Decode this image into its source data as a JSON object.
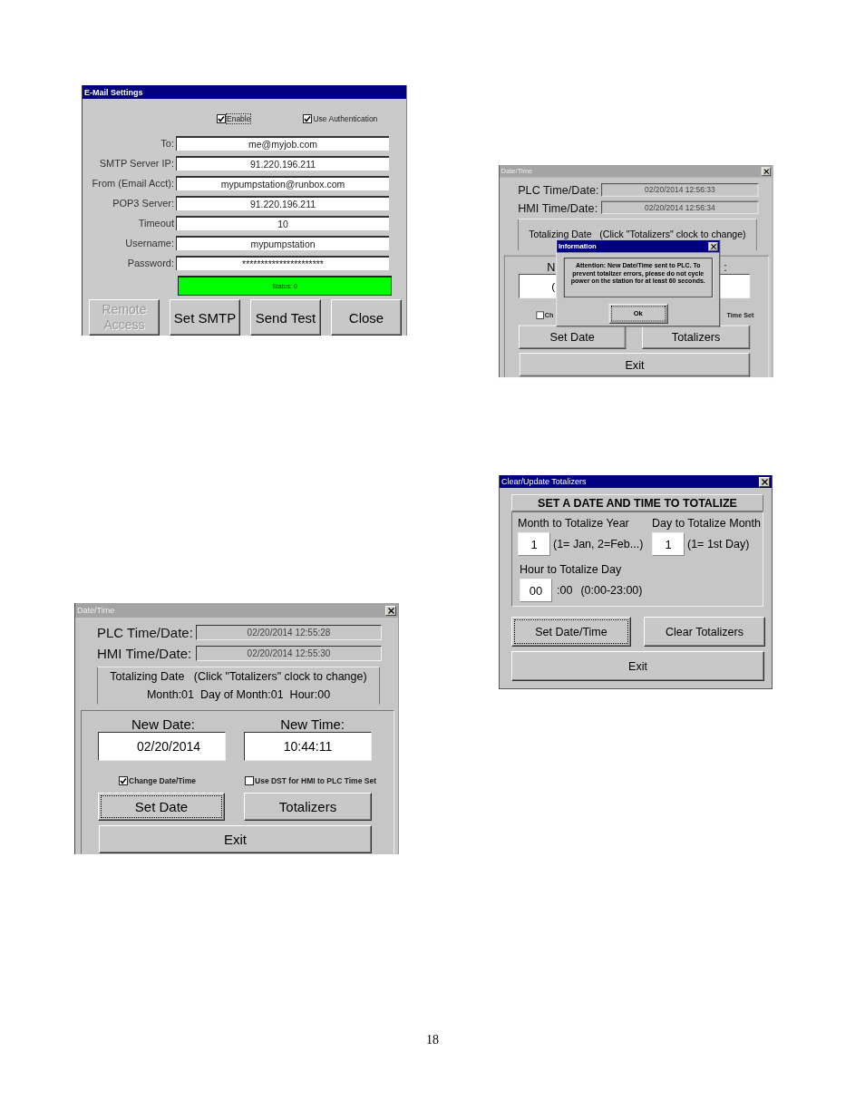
{
  "email_settings": {
    "title": "E-Mail Settings",
    "active": true,
    "checkboxes": [
      {
        "label": "Enable",
        "checked": true,
        "focused": true
      },
      {
        "label": "Use Authentication",
        "checked": true,
        "focused": false
      }
    ],
    "fields": [
      {
        "label": "To:",
        "value": "me@myjob.com"
      },
      {
        "label": "SMTP Server IP:",
        "value": "91.220.196.211"
      },
      {
        "label": "From (Email Acct):",
        "value": "mypumpstation@runbox.com"
      },
      {
        "label": "POP3 Server:",
        "value": "91.220.196.211"
      },
      {
        "label": "Timeout",
        "value": "10"
      },
      {
        "label": "Username:",
        "value": "mypumpstation"
      },
      {
        "label": "Password:",
        "value": "**********************"
      }
    ],
    "status": "Status: 0",
    "buttons": [
      {
        "label": "Remote Access",
        "disabled": true
      },
      {
        "label": "Set SMTP",
        "disabled": false
      },
      {
        "label": "Send Test",
        "disabled": false
      },
      {
        "label": "Close",
        "disabled": false
      }
    ]
  },
  "date_time_with_message": {
    "title": "Date/Time",
    "active": false,
    "close_button": true,
    "plc": {
      "label": "PLC Time/Date:",
      "value": "02/20/2014 12:56:33"
    },
    "hmi": {
      "label": "HMI Time/Date:",
      "value": "02/20/2014 12:56:34"
    },
    "totalizing": [
      "Totalizing Date   (Click \"Totalizers\" clock to change)"
    ],
    "new_date": {
      "label": "N",
      "value": "("
    },
    "new_time": {
      "label": ":"
    },
    "checkboxes": [
      {
        "label": "Ch",
        "checked": false
      },
      {
        "label": "Time Set"
      }
    ],
    "buttons": [
      {
        "label": "Set Date",
        "focused": false
      },
      {
        "label": "Totalizers",
        "focused": false
      }
    ],
    "exit": "Exit",
    "message": {
      "title": "Information",
      "active": true,
      "close_button": true,
      "text": "Attention: New Date/Time sent to PLC. To prevent totalizer errors, please do not cycle power on the station for at least 60 seconds.",
      "button": "Ok",
      "button_focused": true
    }
  },
  "clear_totalizers": {
    "title": "Clear/Update Totalizers",
    "active": true,
    "close_button": true,
    "heading": "SET A DATE AND TIME TO TOTALIZE",
    "inputs": [
      {
        "label": "Month to Totalize Year",
        "value": "1",
        "hint": "(1= Jan, 2=Feb...)"
      },
      {
        "label": "Day to Totalize Month",
        "value": "1",
        "hint": "(1= 1st Day)"
      },
      {
        "label": "Hour to Totalize Day",
        "value": "00",
        "suffix": ":00",
        "hint": "(0:00-23:00)"
      }
    ],
    "buttons": [
      {
        "label": "Set Date/Time",
        "focused": true
      },
      {
        "label": "Clear Totalizers",
        "focused": false
      }
    ],
    "exit": "Exit"
  },
  "date_time": {
    "title": "Date/Time",
    "active": false,
    "close_button": true,
    "plc": {
      "label": "PLC Time/Date:",
      "value": "02/20/2014 12:55:28"
    },
    "hmi": {
      "label": "HMI Time/Date:",
      "value": "02/20/2014 12:55:30"
    },
    "totalizing": [
      "Totalizing Date   (Click \"Totalizers\" clock to change)",
      "Month:01  Day of Month:01  Hour:00"
    ],
    "new_date": {
      "label": "New Date:",
      "value": "02/20/2014"
    },
    "new_time": {
      "label": "New Time:",
      "value": "10:44:11"
    },
    "checkboxes": [
      {
        "label": "Change Date/Time",
        "checked": true
      },
      {
        "label": "Use DST for HMI to PLC Time Set",
        "checked": false
      }
    ],
    "buttons": [
      {
        "label": "Set Date",
        "focused": true
      },
      {
        "label": "Totalizers",
        "focused": false
      }
    ],
    "exit": "Exit"
  },
  "page_number": "18"
}
